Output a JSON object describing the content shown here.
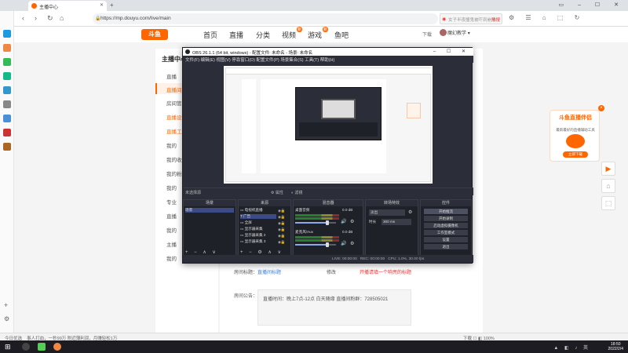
{
  "browser": {
    "tab_title": "主播中心",
    "new_tab": "+",
    "window_controls": "▭ – ☐ ✕",
    "back": "‹",
    "forward": "›",
    "reload": "↻",
    "home": "⌂",
    "url": "https://mp.douyu.com/live/main",
    "search_placeholder": "女子半夜撞鬼被吓到崩溃",
    "search_tag": "热搜",
    "toolbar_icons": "⚙ ☰ ⌂ ⬚ ↻"
  },
  "site": {
    "logo": "斗鱼",
    "nav": [
      {
        "label": "首页"
      },
      {
        "label": "直播"
      },
      {
        "label": "分类"
      },
      {
        "label": "视频",
        "badge": "新"
      },
      {
        "label": "游戏",
        "badge": "新"
      },
      {
        "label": "鱼吧"
      }
    ],
    "download": "下载",
    "username": "魔幻教学"
  },
  "leftnav": {
    "title": "主播中心",
    "items": [
      {
        "label": "直播",
        "icon": "mic-icon"
      },
      {
        "label": "直播间",
        "active": true
      },
      {
        "label": "房间管理"
      },
      {
        "label": "直播设置",
        "orange": true
      },
      {
        "label": "直播工具",
        "orange": true
      },
      {
        "label": "我的"
      },
      {
        "label": "我的收益"
      },
      {
        "label": "我的粉丝"
      },
      {
        "label": "我的"
      },
      {
        "label": "专业"
      },
      {
        "label": "直播"
      },
      {
        "label": "我的"
      },
      {
        "label": "主播"
      },
      {
        "label": "我的"
      }
    ]
  },
  "form": {
    "room_title_label": "房间标题：",
    "room_title_action": "修改",
    "room_title_hint": "直播间标题",
    "room_title_red": "开播请填一个响亮的标题",
    "notice_label": "房间公告：",
    "notice_text": "直播时间：晚上7点-12点 白天随缘 直播间粉群：728505021"
  },
  "promo": {
    "title": "斗鱼直播伴侣",
    "subtitle": "最新最好的直播辅助工具",
    "button": "立即下载",
    "close": "×"
  },
  "sidetools": [
    "▶",
    "⌂",
    "⬚"
  ],
  "obs": {
    "title": "OBS 26.1.1 (64 bit, windows) - 配置文件: 未命名 - 场景: 未命名",
    "menu": "文件(F)  编辑(E)  视图(V)  停靠窗口(D)  配置文件(P)  场景集合(S)  工具(T)  帮助(H)",
    "source_bar": "未选择源",
    "source_bar_props": "⚙ 属性",
    "source_bar_filters": "◐ 滤镜",
    "panels": {
      "scenes": {
        "title": "场景",
        "items": [
          "场景"
        ],
        "footer": "+ − ∧ ∨"
      },
      "sources": {
        "title": "来源",
        "items": [
          "电视机直播",
          "广告",
          "全屏",
          "显示器采集",
          "显示器采集 2",
          "显示器采集 3"
        ],
        "footer": "+ − ⚙ ∧ ∨"
      },
      "mixer": {
        "title": "混音器",
        "channels": [
          {
            "name": "桌面音频",
            "db": "0.0 dB",
            "level": 0.78
          },
          {
            "name": "麦克风/Aux",
            "db": "0.0 dB",
            "level": 0.78
          }
        ]
      },
      "transitions": {
        "title": "转场特效",
        "type": "淡出",
        "duration_label": "时长",
        "duration": "300 ms"
      },
      "controls": {
        "title": "控件",
        "buttons": [
          "开始推流",
          "开始录制",
          "启动虚拟摄像机",
          "工作室模式",
          "设置",
          "退出"
        ]
      }
    },
    "status": {
      "live": "LIVE: 00:00:00",
      "rec": "REC: 00:00:00",
      "cpu": "CPU: 1.0%, 30.00 fps"
    }
  },
  "statusbar": {
    "left": "今日优选",
    "news": "事人打血，一秒99万  附近薄利润，月赚轻松1万",
    "right": "下载  ☐  ◧  100%"
  },
  "taskbar": {
    "tray": "▲ ◧ ♪ 英",
    "time": "18:50",
    "date": "2022/2/4"
  }
}
